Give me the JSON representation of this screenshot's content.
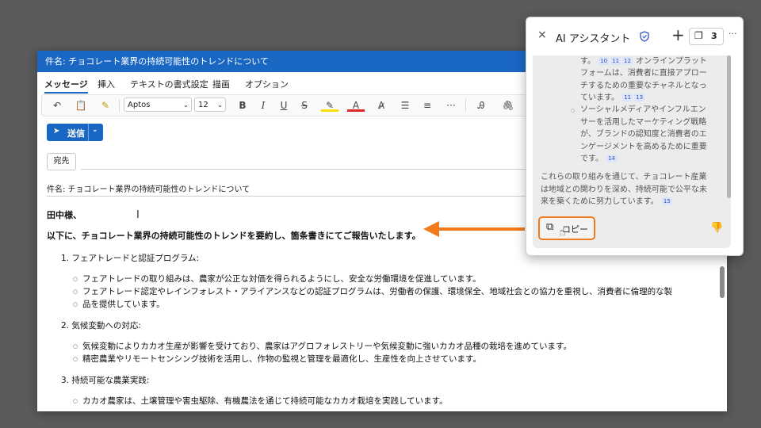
{
  "window": {
    "title": "件名: チョコレート業界の持続可能性のトレンドについて"
  },
  "tabs": [
    "メッセージ",
    "挿入",
    "テキストの書式設定",
    "描画",
    "オプション"
  ],
  "format": {
    "font": "Aptos",
    "size": "12"
  },
  "send": {
    "label": "送信"
  },
  "to": {
    "label": "宛先"
  },
  "subject": "件名: チョコレート業界の持続可能性のトレンドについて",
  "email": {
    "greeting": "田中様、",
    "intro": "以下に、チョコレート業界の持続可能性のトレンドを要約し、箇条書きにてご報告いたします。",
    "sections": [
      {
        "title": "1. フェアトレードと認証プログラム:",
        "bullets": [
          "フェアトレードの取り組みは、農家が公正な対価を得られるようにし、安全な労働環境を促進しています。",
          "フェアトレード認定やレインフォレスト・アライアンスなどの認証プログラムは、労働者の保護、環境保全、地域社会との協力を重視し、消費者に倫理的な製",
          "品を提供しています。"
        ]
      },
      {
        "title": "2. 気候変動への対応:",
        "bullets": [
          "気候変動によりカカオ生産が影響を受けており、農家はアグロフォレストリーや気候変動に強いカカオ品種の栽培を進めています。",
          "精密農業やリモートセンシング技術を活用し、作物の監視と管理を最適化し、生産性を向上させています。"
        ]
      },
      {
        "title": "3. 持続可能な農業実践:",
        "bullets": [
          "カカオ農家は、土壌管理や害虫駆除、有機農法を通じて持続可能なカカオ栽培を実践しています。"
        ]
      }
    ]
  },
  "assistant": {
    "title": "AI アシスタント",
    "close": "×",
    "new": "+",
    "pages_count": "3",
    "more": "···",
    "lines": [
      {
        "text": "す。",
        "cites": [
          "10",
          "11",
          "12"
        ],
        "tail": "オンラインプラット"
      },
      {
        "text": "フォームは、消費者に直接アプロー"
      },
      {
        "text": "チするための重要なチャネルとなっ"
      },
      {
        "text": "ています。",
        "cites": [
          "11",
          "13"
        ]
      }
    ],
    "bullet2": [
      "ソーシャルメディアやインフルエン",
      "サーを活用したマーケティング戦略",
      "が、ブランドの認知度と消費者のエ",
      "ンゲージメントを高めるために重要",
      "です。"
    ],
    "bullet2_cite": "14",
    "summary": [
      "これらの取り組みを通じて、チョコレート産業",
      "は地域との関わりを深め、持続可能で公平な未",
      "来を築くために努力しています。"
    ],
    "summary_cite": "15",
    "copy_label": "コピー"
  },
  "colors": {
    "accent": "#1a67c3",
    "highlight": "#f07a1c"
  }
}
